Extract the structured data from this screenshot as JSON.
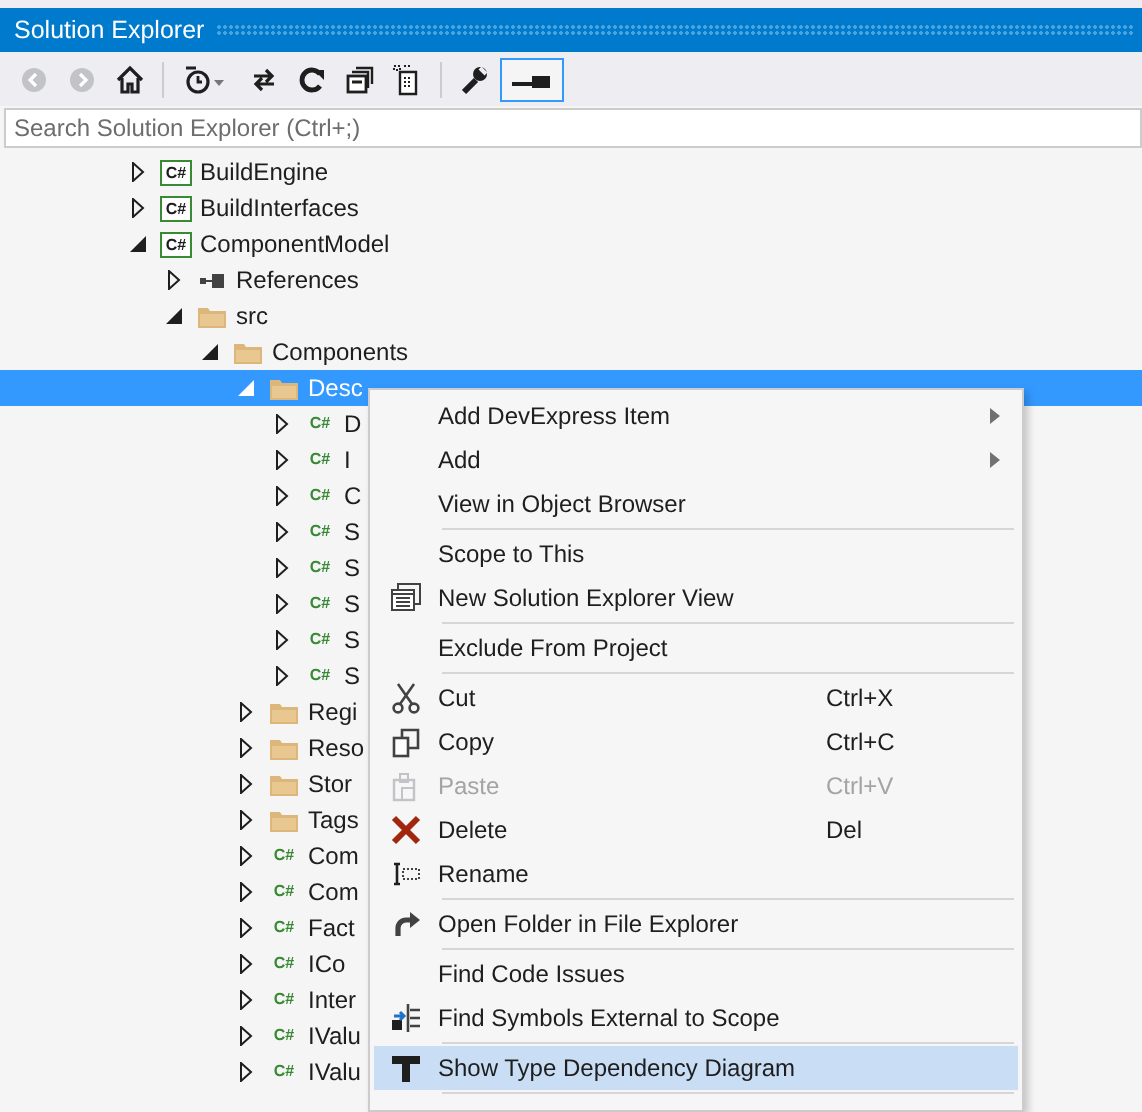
{
  "window": {
    "title": "Solution Explorer"
  },
  "toolbar": {
    "buttons": [
      {
        "disabled": true
      },
      {
        "disabled": true
      },
      {
        "disabled": false
      },
      {
        "disabled": false
      },
      {
        "disabled": false
      },
      {
        "disabled": false
      },
      {
        "disabled": false
      },
      {
        "disabled": false
      },
      {
        "disabled": false
      },
      {
        "disabled": false,
        "checked": true
      }
    ]
  },
  "search": {
    "placeholder": "Search Solution Explorer (Ctrl+;)"
  },
  "tree": [
    {
      "label": "BuildEngine",
      "kind": "project",
      "icon_text": "C#",
      "expanded": false,
      "selected": false
    },
    {
      "label": "BuildInterfaces",
      "kind": "project",
      "icon_text": "C#",
      "expanded": false,
      "selected": false
    },
    {
      "label": "ComponentModel",
      "kind": "project",
      "icon_text": "C#",
      "expanded": true,
      "selected": false,
      "children": [
        {
          "label": "References",
          "kind": "references",
          "expanded": false,
          "selected": false
        },
        {
          "label": "src",
          "kind": "folder",
          "expanded": true,
          "selected": false,
          "children": [
            {
              "label": "Components",
              "kind": "folder",
              "expanded": true,
              "selected": false,
              "children": [
                {
                  "label": "Desc",
                  "kind": "folder",
                  "expanded": true,
                  "selected": true,
                  "children": [
                    {
                      "label": "D",
                      "kind": "file",
                      "icon_text": "C#",
                      "expanded": false,
                      "selected": false
                    },
                    {
                      "label": "I",
                      "kind": "file",
                      "icon_text": "C#",
                      "expanded": false,
                      "selected": false
                    },
                    {
                      "label": "C",
                      "kind": "file",
                      "icon_text": "C#",
                      "expanded": false,
                      "selected": false
                    },
                    {
                      "label": "S",
                      "kind": "file",
                      "icon_text": "C#",
                      "expanded": false,
                      "selected": false
                    },
                    {
                      "label": "S",
                      "kind": "file",
                      "icon_text": "C#",
                      "expanded": false,
                      "selected": false
                    },
                    {
                      "label": "S",
                      "kind": "file",
                      "icon_text": "C#",
                      "expanded": false,
                      "selected": false
                    },
                    {
                      "label": "S",
                      "kind": "file",
                      "icon_text": "C#",
                      "expanded": false,
                      "selected": false
                    },
                    {
                      "label": "S",
                      "kind": "file",
                      "icon_text": "C#",
                      "expanded": false,
                      "selected": false
                    }
                  ]
                },
                {
                  "label": "Regi",
                  "kind": "folder",
                  "expanded": false,
                  "selected": false
                },
                {
                  "label": "Reso",
                  "kind": "folder",
                  "expanded": false,
                  "selected": false
                },
                {
                  "label": "Stor",
                  "kind": "folder",
                  "expanded": false,
                  "selected": false
                },
                {
                  "label": "Tags",
                  "kind": "folder",
                  "expanded": false,
                  "selected": false
                },
                {
                  "label": "Com",
                  "kind": "file",
                  "icon_text": "C#",
                  "expanded": false,
                  "selected": false
                },
                {
                  "label": "Com",
                  "kind": "file",
                  "icon_text": "C#",
                  "expanded": false,
                  "selected": false
                },
                {
                  "label": "Fact",
                  "kind": "file",
                  "icon_text": "C#",
                  "expanded": false,
                  "selected": false
                },
                {
                  "label": "ICo",
                  "kind": "file",
                  "icon_text": "C#",
                  "expanded": false,
                  "selected": false
                },
                {
                  "label": "Inter",
                  "kind": "file",
                  "icon_text": "C#",
                  "expanded": false,
                  "selected": false
                },
                {
                  "label": "IValu",
                  "kind": "file",
                  "icon_text": "C#",
                  "expanded": false,
                  "selected": false
                },
                {
                  "label": "IValu",
                  "kind": "file",
                  "icon_text": "C#",
                  "expanded": false,
                  "selected": false
                }
              ]
            }
          ]
        }
      ]
    }
  ],
  "context_menu": {
    "items": [
      {
        "kind": "item",
        "label": "Add DevExpress Item",
        "submenu": true,
        "disabled": false,
        "selected": false
      },
      {
        "kind": "item",
        "label": "Add",
        "submenu": true,
        "disabled": false,
        "selected": false
      },
      {
        "kind": "item",
        "label": "View in Object Browser",
        "submenu": false,
        "disabled": false,
        "selected": false
      },
      {
        "kind": "separator"
      },
      {
        "kind": "item",
        "label": "Scope to This",
        "submenu": false,
        "disabled": false,
        "selected": false
      },
      {
        "kind": "item",
        "label": "New Solution Explorer View",
        "submenu": false,
        "disabled": false,
        "selected": false
      },
      {
        "kind": "separator"
      },
      {
        "kind": "item",
        "label": "Exclude From Project",
        "submenu": false,
        "disabled": false,
        "selected": false
      },
      {
        "kind": "separator"
      },
      {
        "kind": "item",
        "label": "Cut",
        "shortcut": "Ctrl+X",
        "submenu": false,
        "disabled": false,
        "selected": false
      },
      {
        "kind": "item",
        "label": "Copy",
        "shortcut": "Ctrl+C",
        "submenu": false,
        "disabled": false,
        "selected": false
      },
      {
        "kind": "item",
        "label": "Paste",
        "shortcut": "Ctrl+V",
        "submenu": false,
        "disabled": true,
        "selected": false
      },
      {
        "kind": "item",
        "label": "Delete",
        "shortcut": "Del",
        "submenu": false,
        "disabled": false,
        "selected": false
      },
      {
        "kind": "item",
        "label": "Rename",
        "submenu": false,
        "disabled": false,
        "selected": false
      },
      {
        "kind": "separator"
      },
      {
        "kind": "item",
        "label": "Open Folder in File Explorer",
        "submenu": false,
        "disabled": false,
        "selected": false
      },
      {
        "kind": "separator"
      },
      {
        "kind": "item",
        "label": "Find Code Issues",
        "submenu": false,
        "disabled": false,
        "selected": false
      },
      {
        "kind": "item",
        "label": "Find Symbols External to Scope",
        "submenu": false,
        "disabled": false,
        "selected": false
      },
      {
        "kind": "separator"
      },
      {
        "kind": "item",
        "label": "Show Type Dependency Diagram",
        "submenu": false,
        "disabled": false,
        "selected": true
      },
      {
        "kind": "separator"
      }
    ]
  }
}
